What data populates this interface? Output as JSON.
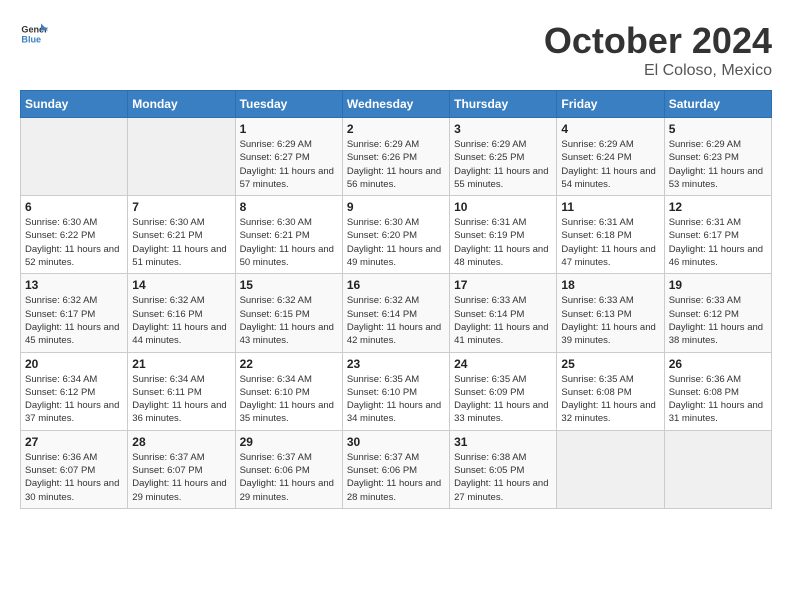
{
  "logo": {
    "text_general": "General",
    "text_blue": "Blue"
  },
  "header": {
    "month": "October 2024",
    "location": "El Coloso, Mexico"
  },
  "weekdays": [
    "Sunday",
    "Monday",
    "Tuesday",
    "Wednesday",
    "Thursday",
    "Friday",
    "Saturday"
  ],
  "weeks": [
    [
      {
        "day": "",
        "empty": true
      },
      {
        "day": "",
        "empty": true
      },
      {
        "day": "1",
        "sunrise": "Sunrise: 6:29 AM",
        "sunset": "Sunset: 6:27 PM",
        "daylight": "Daylight: 11 hours and 57 minutes."
      },
      {
        "day": "2",
        "sunrise": "Sunrise: 6:29 AM",
        "sunset": "Sunset: 6:26 PM",
        "daylight": "Daylight: 11 hours and 56 minutes."
      },
      {
        "day": "3",
        "sunrise": "Sunrise: 6:29 AM",
        "sunset": "Sunset: 6:25 PM",
        "daylight": "Daylight: 11 hours and 55 minutes."
      },
      {
        "day": "4",
        "sunrise": "Sunrise: 6:29 AM",
        "sunset": "Sunset: 6:24 PM",
        "daylight": "Daylight: 11 hours and 54 minutes."
      },
      {
        "day": "5",
        "sunrise": "Sunrise: 6:29 AM",
        "sunset": "Sunset: 6:23 PM",
        "daylight": "Daylight: 11 hours and 53 minutes."
      }
    ],
    [
      {
        "day": "6",
        "sunrise": "Sunrise: 6:30 AM",
        "sunset": "Sunset: 6:22 PM",
        "daylight": "Daylight: 11 hours and 52 minutes."
      },
      {
        "day": "7",
        "sunrise": "Sunrise: 6:30 AM",
        "sunset": "Sunset: 6:21 PM",
        "daylight": "Daylight: 11 hours and 51 minutes."
      },
      {
        "day": "8",
        "sunrise": "Sunrise: 6:30 AM",
        "sunset": "Sunset: 6:21 PM",
        "daylight": "Daylight: 11 hours and 50 minutes."
      },
      {
        "day": "9",
        "sunrise": "Sunrise: 6:30 AM",
        "sunset": "Sunset: 6:20 PM",
        "daylight": "Daylight: 11 hours and 49 minutes."
      },
      {
        "day": "10",
        "sunrise": "Sunrise: 6:31 AM",
        "sunset": "Sunset: 6:19 PM",
        "daylight": "Daylight: 11 hours and 48 minutes."
      },
      {
        "day": "11",
        "sunrise": "Sunrise: 6:31 AM",
        "sunset": "Sunset: 6:18 PM",
        "daylight": "Daylight: 11 hours and 47 minutes."
      },
      {
        "day": "12",
        "sunrise": "Sunrise: 6:31 AM",
        "sunset": "Sunset: 6:17 PM",
        "daylight": "Daylight: 11 hours and 46 minutes."
      }
    ],
    [
      {
        "day": "13",
        "sunrise": "Sunrise: 6:32 AM",
        "sunset": "Sunset: 6:17 PM",
        "daylight": "Daylight: 11 hours and 45 minutes."
      },
      {
        "day": "14",
        "sunrise": "Sunrise: 6:32 AM",
        "sunset": "Sunset: 6:16 PM",
        "daylight": "Daylight: 11 hours and 44 minutes."
      },
      {
        "day": "15",
        "sunrise": "Sunrise: 6:32 AM",
        "sunset": "Sunset: 6:15 PM",
        "daylight": "Daylight: 11 hours and 43 minutes."
      },
      {
        "day": "16",
        "sunrise": "Sunrise: 6:32 AM",
        "sunset": "Sunset: 6:14 PM",
        "daylight": "Daylight: 11 hours and 42 minutes."
      },
      {
        "day": "17",
        "sunrise": "Sunrise: 6:33 AM",
        "sunset": "Sunset: 6:14 PM",
        "daylight": "Daylight: 11 hours and 41 minutes."
      },
      {
        "day": "18",
        "sunrise": "Sunrise: 6:33 AM",
        "sunset": "Sunset: 6:13 PM",
        "daylight": "Daylight: 11 hours and 39 minutes."
      },
      {
        "day": "19",
        "sunrise": "Sunrise: 6:33 AM",
        "sunset": "Sunset: 6:12 PM",
        "daylight": "Daylight: 11 hours and 38 minutes."
      }
    ],
    [
      {
        "day": "20",
        "sunrise": "Sunrise: 6:34 AM",
        "sunset": "Sunset: 6:12 PM",
        "daylight": "Daylight: 11 hours and 37 minutes."
      },
      {
        "day": "21",
        "sunrise": "Sunrise: 6:34 AM",
        "sunset": "Sunset: 6:11 PM",
        "daylight": "Daylight: 11 hours and 36 minutes."
      },
      {
        "day": "22",
        "sunrise": "Sunrise: 6:34 AM",
        "sunset": "Sunset: 6:10 PM",
        "daylight": "Daylight: 11 hours and 35 minutes."
      },
      {
        "day": "23",
        "sunrise": "Sunrise: 6:35 AM",
        "sunset": "Sunset: 6:10 PM",
        "daylight": "Daylight: 11 hours and 34 minutes."
      },
      {
        "day": "24",
        "sunrise": "Sunrise: 6:35 AM",
        "sunset": "Sunset: 6:09 PM",
        "daylight": "Daylight: 11 hours and 33 minutes."
      },
      {
        "day": "25",
        "sunrise": "Sunrise: 6:35 AM",
        "sunset": "Sunset: 6:08 PM",
        "daylight": "Daylight: 11 hours and 32 minutes."
      },
      {
        "day": "26",
        "sunrise": "Sunrise: 6:36 AM",
        "sunset": "Sunset: 6:08 PM",
        "daylight": "Daylight: 11 hours and 31 minutes."
      }
    ],
    [
      {
        "day": "27",
        "sunrise": "Sunrise: 6:36 AM",
        "sunset": "Sunset: 6:07 PM",
        "daylight": "Daylight: 11 hours and 30 minutes."
      },
      {
        "day": "28",
        "sunrise": "Sunrise: 6:37 AM",
        "sunset": "Sunset: 6:07 PM",
        "daylight": "Daylight: 11 hours and 29 minutes."
      },
      {
        "day": "29",
        "sunrise": "Sunrise: 6:37 AM",
        "sunset": "Sunset: 6:06 PM",
        "daylight": "Daylight: 11 hours and 29 minutes."
      },
      {
        "day": "30",
        "sunrise": "Sunrise: 6:37 AM",
        "sunset": "Sunset: 6:06 PM",
        "daylight": "Daylight: 11 hours and 28 minutes."
      },
      {
        "day": "31",
        "sunrise": "Sunrise: 6:38 AM",
        "sunset": "Sunset: 6:05 PM",
        "daylight": "Daylight: 11 hours and 27 minutes."
      },
      {
        "day": "",
        "empty": true
      },
      {
        "day": "",
        "empty": true
      }
    ]
  ]
}
